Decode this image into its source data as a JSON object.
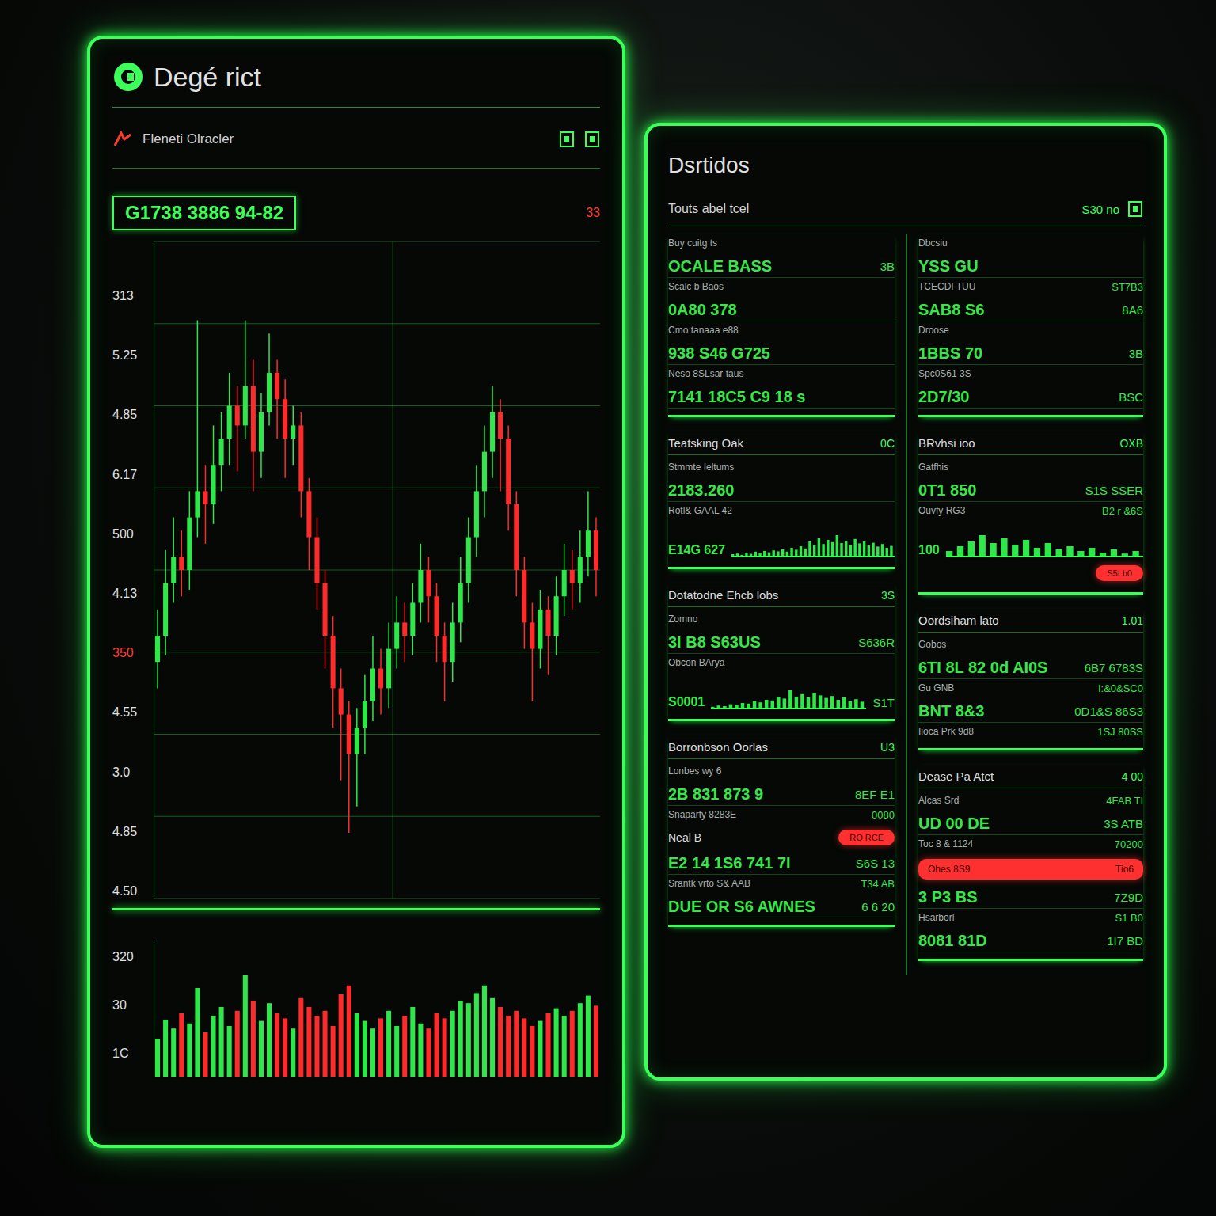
{
  "left_panel": {
    "title": "Degé rict",
    "subtitle": "Fleneti Olracler",
    "corner_reading": "33",
    "price": "G1738 3886 94-82",
    "chart": {
      "y_ticks": [
        {
          "label": "313",
          "color": "#e0e0e0"
        },
        {
          "label": "5.25",
          "color": "#e0e0e0"
        },
        {
          "label": "4.85",
          "color": "#e0e0e0"
        },
        {
          "label": "6.17",
          "color": "#e0e0e0"
        },
        {
          "label": "500",
          "color": "#e0e0e0"
        },
        {
          "label": "4.13",
          "color": "#e0e0e0"
        },
        {
          "label": "350",
          "color": "#ff3b30"
        },
        {
          "label": "4.55",
          "color": "#e0e0e0"
        },
        {
          "label": "3.0",
          "color": "#e0e0e0"
        },
        {
          "label": "4.85",
          "color": "#e0e0e0"
        },
        {
          "label": "4.50",
          "color": "#e0e0e0"
        }
      ],
      "candles": [
        [
          36,
          44,
          32,
          40
        ],
        [
          40,
          53,
          37,
          48
        ],
        [
          48,
          58,
          45,
          52
        ],
        [
          52,
          56,
          46,
          50
        ],
        [
          50,
          62,
          47,
          58
        ],
        [
          58,
          88,
          55,
          62
        ],
        [
          62,
          66,
          54,
          60
        ],
        [
          60,
          72,
          57,
          66
        ],
        [
          66,
          74,
          62,
          70
        ],
        [
          70,
          80,
          66,
          75
        ],
        [
          75,
          78,
          65,
          72
        ],
        [
          72,
          88,
          70,
          78
        ],
        [
          78,
          82,
          62,
          68
        ],
        [
          68,
          77,
          64,
          74
        ],
        [
          74,
          86,
          72,
          80
        ],
        [
          80,
          82,
          70,
          76
        ],
        [
          76,
          79,
          64,
          70
        ],
        [
          70,
          75,
          66,
          72
        ],
        [
          72,
          74,
          58,
          62
        ],
        [
          62,
          64,
          50,
          55
        ],
        [
          55,
          58,
          44,
          48
        ],
        [
          48,
          50,
          35,
          40
        ],
        [
          40,
          43,
          26,
          32
        ],
        [
          32,
          35,
          18,
          28
        ],
        [
          28,
          30,
          10,
          22
        ],
        [
          22,
          29,
          14,
          26
        ],
        [
          26,
          34,
          22,
          30
        ],
        [
          30,
          40,
          27,
          35
        ],
        [
          35,
          38,
          28,
          32
        ],
        [
          32,
          42,
          29,
          38
        ],
        [
          38,
          46,
          35,
          42
        ],
        [
          42,
          45,
          36,
          40
        ],
        [
          40,
          48,
          37,
          45
        ],
        [
          45,
          54,
          42,
          50
        ],
        [
          50,
          52,
          42,
          46
        ],
        [
          46,
          48,
          36,
          40
        ],
        [
          40,
          42,
          30,
          36
        ],
        [
          36,
          45,
          33,
          42
        ],
        [
          42,
          52,
          39,
          48
        ],
        [
          48,
          58,
          45,
          55
        ],
        [
          55,
          66,
          52,
          62
        ],
        [
          62,
          72,
          58,
          68
        ],
        [
          68,
          78,
          64,
          74
        ],
        [
          74,
          76,
          62,
          70
        ],
        [
          70,
          72,
          56,
          60
        ],
        [
          60,
          62,
          46,
          50
        ],
        [
          50,
          52,
          38,
          42
        ],
        [
          42,
          45,
          30,
          38
        ],
        [
          38,
          47,
          35,
          44
        ],
        [
          44,
          46,
          34,
          40
        ],
        [
          40,
          49,
          37,
          46
        ],
        [
          46,
          54,
          43,
          50
        ],
        [
          50,
          53,
          44,
          48
        ],
        [
          48,
          56,
          45,
          52
        ],
        [
          52,
          62,
          49,
          56
        ],
        [
          56,
          58,
          46,
          50
        ]
      ]
    },
    "volume": {
      "y_ticks": [
        "320",
        "30",
        "1C"
      ],
      "values": [
        30,
        45,
        38,
        50,
        42,
        70,
        35,
        48,
        55,
        40,
        52,
        80,
        60,
        44,
        58,
        50,
        46,
        38,
        62,
        55,
        48,
        52,
        40,
        65,
        72,
        50,
        44,
        38,
        46,
        52,
        40,
        48,
        55,
        42,
        38,
        50,
        46,
        52,
        60,
        58,
        66,
        72,
        62,
        55,
        48,
        52,
        46,
        40,
        44,
        50,
        54,
        48,
        52,
        58,
        64,
        56
      ]
    }
  },
  "right_panel": {
    "title": "Dsrtidos",
    "header": "Touts abel tcel",
    "header_right": "S30 no",
    "columns": [
      {
        "sections": [
          {
            "rows": [
              {
                "kind": "sub",
                "text": "Buy cuitg ts"
              },
              {
                "kind": "value",
                "text": "OCALE BASS",
                "right": "3B"
              },
              {
                "kind": "sub",
                "text": "Scalc b Baos"
              },
              {
                "kind": "value",
                "text": "0A80 378"
              },
              {
                "kind": "sub",
                "text": "Cmo tanaaa e88"
              },
              {
                "kind": "value",
                "text": "938 S46 G725"
              },
              {
                "kind": "sub",
                "text": "Neso 8SLsar taus"
              },
              {
                "kind": "value",
                "text": "7141 18C5 C9 18 s"
              }
            ]
          },
          {
            "title": "Teatsking Oak",
            "right": "0C",
            "rows": [
              {
                "kind": "sub",
                "text": "Stmmte Ieltums"
              },
              {
                "kind": "value",
                "text": "2183.260"
              },
              {
                "kind": "sub",
                "text": "Rotl& GAAL 42"
              },
              {
                "kind": "spark",
                "text": "E14G 627",
                "values": [
                  10,
                  12,
                  8,
                  15,
                  11,
                  18,
                  14,
                  20,
                  16,
                  22,
                  19,
                  25,
                  18,
                  30,
                  24,
                  35,
                  28,
                  50,
                  38,
                  60,
                  42,
                  55,
                  48,
                  70,
                  45,
                  52,
                  40,
                  58,
                  44,
                  50,
                  38,
                  46,
                  34,
                  42,
                  30,
                  36
                ]
              }
            ]
          },
          {
            "title": "Dotatodne Ehcb lobs",
            "right": "3S",
            "rows": [
              {
                "kind": "sub",
                "text": "Zomno"
              },
              {
                "kind": "value",
                "text": "3I B8 S63US",
                "right": "S636R"
              },
              {
                "kind": "sub",
                "text": "Obcon BArya"
              },
              {
                "kind": "spark",
                "text": "S0001",
                "right": "S1T",
                "values": [
                  8,
                  12,
                  10,
                  16,
                  14,
                  20,
                  18,
                  26,
                  22,
                  30,
                  28,
                  40,
                  34,
                  60,
                  40,
                  48,
                  38,
                  52,
                  44,
                  36,
                  42,
                  30,
                  38,
                  26,
                  32,
                  24
                ]
              }
            ]
          },
          {
            "title": "Borronbson Oorlas",
            "right": "U3",
            "rows": [
              {
                "kind": "sub",
                "text": "Lonbes wy 6"
              },
              {
                "kind": "value",
                "text": "2B 831 873 9",
                "right": "8EF E1"
              },
              {
                "kind": "sub",
                "text": "Snaparty 8283E",
                "right": "0080"
              },
              {
                "kind": "pill",
                "text": "Neal B",
                "pill": "RO RCE"
              },
              {
                "kind": "value",
                "text": "E2 14 1S6 741 7I",
                "right": "S6S 13"
              },
              {
                "kind": "sub",
                "text": "Srantk vrto S& AAB",
                "right": "T34 AB"
              },
              {
                "kind": "value",
                "text": "DUE OR S6 AWNES",
                "right": "6 6 20"
              }
            ]
          }
        ]
      },
      {
        "sections": [
          {
            "rows": [
              {
                "kind": "sub",
                "text": "Dbcsiu"
              },
              {
                "kind": "value",
                "text": "YSS GU"
              },
              {
                "kind": "sub",
                "text": "TCECDI TUU",
                "right": "ST7B3"
              },
              {
                "kind": "value",
                "text": "SAB8 S6",
                "right": "8A6"
              },
              {
                "kind": "sub",
                "text": "Droose"
              },
              {
                "kind": "value",
                "text": "1BBS 70",
                "right": "3B"
              },
              {
                "kind": "sub",
                "text": "Spc0S61 3S"
              },
              {
                "kind": "value",
                "text": "2D7/30",
                "right": "BSC"
              }
            ]
          },
          {
            "title": "BRvhsi ioo",
            "right": "OXB",
            "rows": [
              {
                "kind": "sub",
                "text": "Gatfhis"
              },
              {
                "kind": "value",
                "text": "0T1 850",
                "right": "S1S SSER"
              },
              {
                "kind": "sub",
                "text": "Ouvfy RG3",
                "right": "B2 r &6S"
              },
              {
                "kind": "spark",
                "text": "100",
                "values": [
                  20,
                  35,
                  50,
                  70,
                  45,
                  60,
                  40,
                  55,
                  30,
                  45,
                  25,
                  35,
                  20,
                  30,
                  15,
                  25,
                  12,
                  20
                ]
              },
              {
                "kind": "pill",
                "pill": "S5t b0"
              }
            ]
          },
          {
            "title": "Oordsiham lato",
            "right": "1.01",
            "rows": [
              {
                "kind": "sub",
                "text": "Gobos"
              },
              {
                "kind": "value",
                "text": "6TI 8L 82 0d AI0S",
                "right": "6B7 6783S"
              },
              {
                "kind": "sub",
                "text": "Gu GNB",
                "right": "I:&0&SC0"
              },
              {
                "kind": "value",
                "text": "BNT 8&3",
                "right": "0D1&S 86S3"
              },
              {
                "kind": "sub",
                "text": "Iioca Prk 9d8",
                "right": "1SJ 80SS"
              }
            ]
          },
          {
            "title": "Dease Pa Atct",
            "right": "4 00",
            "rows": [
              {
                "kind": "sub",
                "text": "Alcas Srd",
                "right": "4FAB TI"
              },
              {
                "kind": "value",
                "text": "UD 00 DE",
                "right": "3S ATB"
              },
              {
                "kind": "sub",
                "text": "Toc 8 & 1124",
                "right": "70200"
              },
              {
                "kind": "alert",
                "text": "Ohes 8S9",
                "right": "Tio6"
              },
              {
                "kind": "value",
                "text": "3 P3 BS",
                "right": "7Z9D"
              },
              {
                "kind": "sub",
                "text": "Hsarborl",
                "right": "S1 B0"
              },
              {
                "kind": "value",
                "text": "8081 81D",
                "right": "1I7 BD"
              }
            ]
          }
        ]
      }
    ]
  }
}
